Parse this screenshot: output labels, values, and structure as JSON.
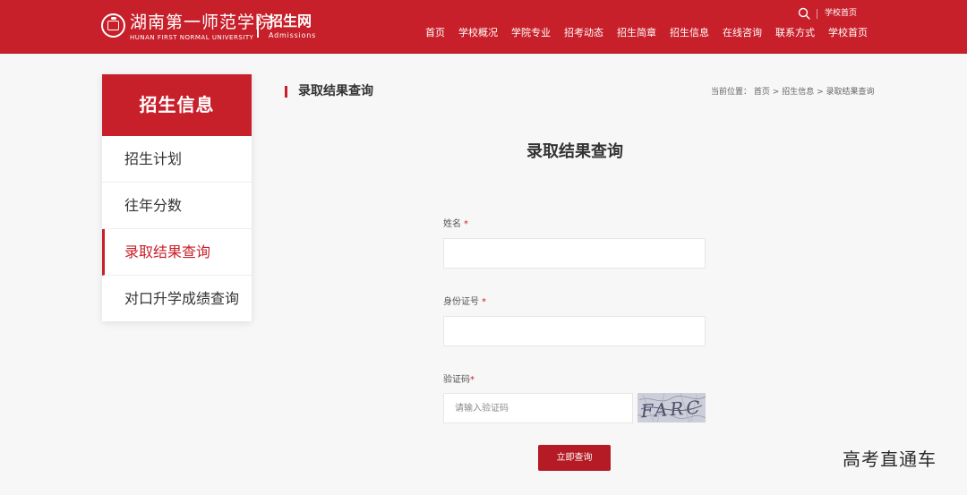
{
  "header": {
    "school_name_cn": "湖南第一师范学院",
    "school_name_en": "HUNAN FIRST NORMAL UNIVERSITY",
    "site_name": "招生网",
    "site_name_en": "Admissions",
    "top_link": "学校首页",
    "nav": [
      "首页",
      "学校概况",
      "学院专业",
      "招考动态",
      "招生简章",
      "招生信息",
      "在线咨询",
      "联系方式",
      "学校首页"
    ]
  },
  "sidebar": {
    "title": "招生信息",
    "items": [
      {
        "label": "招生计划",
        "active": false
      },
      {
        "label": "往年分数",
        "active": false
      },
      {
        "label": "录取结果查询",
        "active": true
      },
      {
        "label": "对口升学成绩查询",
        "active": false
      }
    ]
  },
  "content": {
    "title": "录取结果查询",
    "breadcrumb": {
      "prefix": "当前位置：",
      "items": [
        "首页",
        "招生信息",
        "录取结果查询"
      ],
      "separator": ">"
    }
  },
  "form": {
    "heading": "录取结果查询",
    "name_label": "姓名",
    "name_value": "",
    "id_label": "身份证号",
    "id_value": "",
    "captcha_label": "验证码",
    "captcha_value": "",
    "captcha_placeholder": "请输入验证码",
    "captcha_text": "FARC",
    "required_mark": "*",
    "submit_label": "立即查询"
  },
  "watermark": "高考直通车",
  "colors": {
    "brand_red": "#c8202a",
    "button_red": "#b51b24",
    "page_bg": "#f7f7f7"
  },
  "icons": {
    "search": "search-icon",
    "seal": "school-seal-icon"
  }
}
